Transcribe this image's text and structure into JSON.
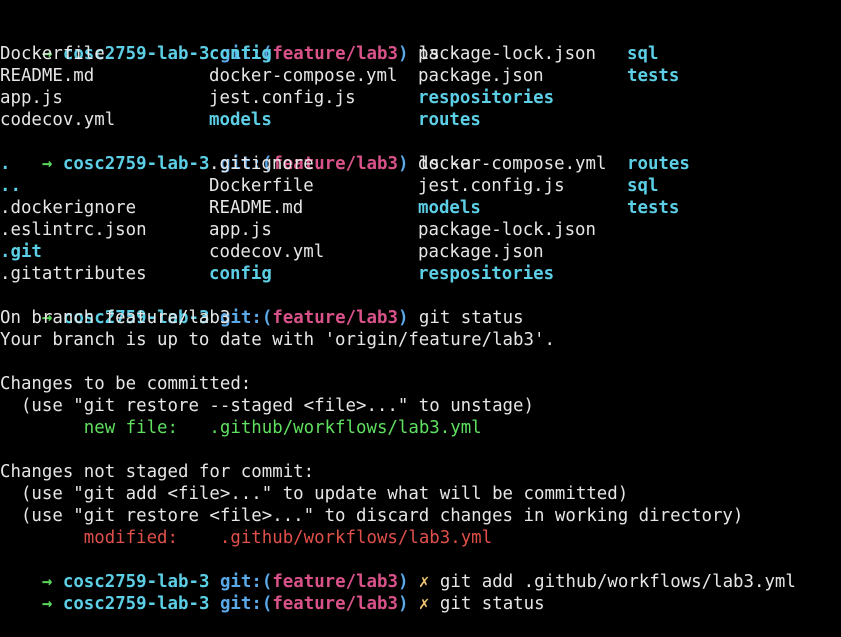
{
  "prompt": {
    "arrow": "→",
    "dir": "cosc2759-lab-3",
    "git_label": "git:",
    "branch_open": "(",
    "branch": "feature/lab3",
    "branch_close": ")",
    "dirty_mark": "✗"
  },
  "commands": {
    "ls": "ls",
    "ls_a": "ls -a",
    "git_status": "git status",
    "git_add": "git add .github/workflows/lab3.yml",
    "git_status_2": "git status"
  },
  "ls_output": [
    [
      "Dockerfile",
      "config",
      "package-lock.json",
      "sql"
    ],
    [
      "README.md",
      "docker-compose.yml",
      "package.json",
      "tests"
    ],
    [
      "app.js",
      "jest.config.js",
      "respositories",
      ""
    ],
    [
      "codecov.yml",
      "models",
      "routes",
      ""
    ]
  ],
  "ls_a_output": [
    [
      ".",
      ".gitignore",
      "docker-compose.yml",
      "routes"
    ],
    [
      "..",
      "Dockerfile",
      "jest.config.js",
      "sql"
    ],
    [
      ".dockerignore",
      "README.md",
      "models",
      "tests"
    ],
    [
      ".eslintrc.json",
      "app.js",
      "package-lock.json",
      ""
    ],
    [
      ".git",
      "codecov.yml",
      "package.json",
      ""
    ],
    [
      ".gitattributes",
      "config",
      "respositories",
      ""
    ]
  ],
  "status": {
    "on_branch": "On branch feature/lab3",
    "up_to_date": "Your branch is up to date with 'origin/feature/lab3'.",
    "staged_header": "Changes to be committed:",
    "staged_hint": "  (use \"git restore --staged <file>...\" to unstage)",
    "staged_kind": "new file:",
    "staged_file": ".github/workflows/lab3.yml",
    "unstaged_header": "Changes not staged for commit:",
    "unstaged_hint_1": "  (use \"git add <file>...\" to update what will be committed)",
    "unstaged_hint_2": "  (use \"git restore <file>...\" to discard changes in working directory)",
    "unstaged_kind": "modified:",
    "unstaged_file": ".github/workflows/lab3.yml"
  },
  "colors": {
    "background": "#000000",
    "text": "#e6e6e6",
    "arrow": "#5ad45a",
    "directory": "#5ccfe6",
    "git_label": "#5aa8e8",
    "branch": "#d9538a",
    "dirty": "#f0c674",
    "staged": "#5fe05f",
    "unstaged": "#e0504a"
  }
}
